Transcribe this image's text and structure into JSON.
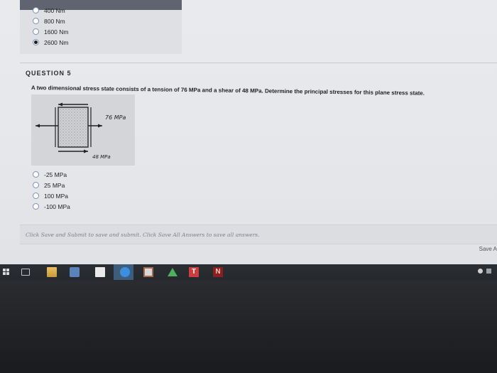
{
  "previous_question": {
    "choices": [
      {
        "label": "400 Nm",
        "selected": false
      },
      {
        "label": "800 Nm",
        "selected": false
      },
      {
        "label": "1600 Nm",
        "selected": false
      },
      {
        "label": "2600 Nm",
        "selected": true
      }
    ]
  },
  "question": {
    "label": "QUESTION 5",
    "text": "A two dimensional stress state consists of a tension of 76 MPa and a shear of 48 MPa. Determine the principal stresses for this plane stress state.",
    "figure": {
      "label_tension": "76 MPa",
      "label_shear": "48 MPa"
    },
    "choices": [
      {
        "label": "-25 MPa",
        "selected": false
      },
      {
        "label": "25 MPa",
        "selected": false
      },
      {
        "label": "100 MPa",
        "selected": false
      },
      {
        "label": "-100 MPa",
        "selected": false
      }
    ]
  },
  "footer": {
    "instruction": "Click Save and Submit to save and submit. Click Save All Answers to save all answers.",
    "save_label": "Save A"
  },
  "taskbar": {
    "teams_letter": "T",
    "notes_letter": "N"
  }
}
